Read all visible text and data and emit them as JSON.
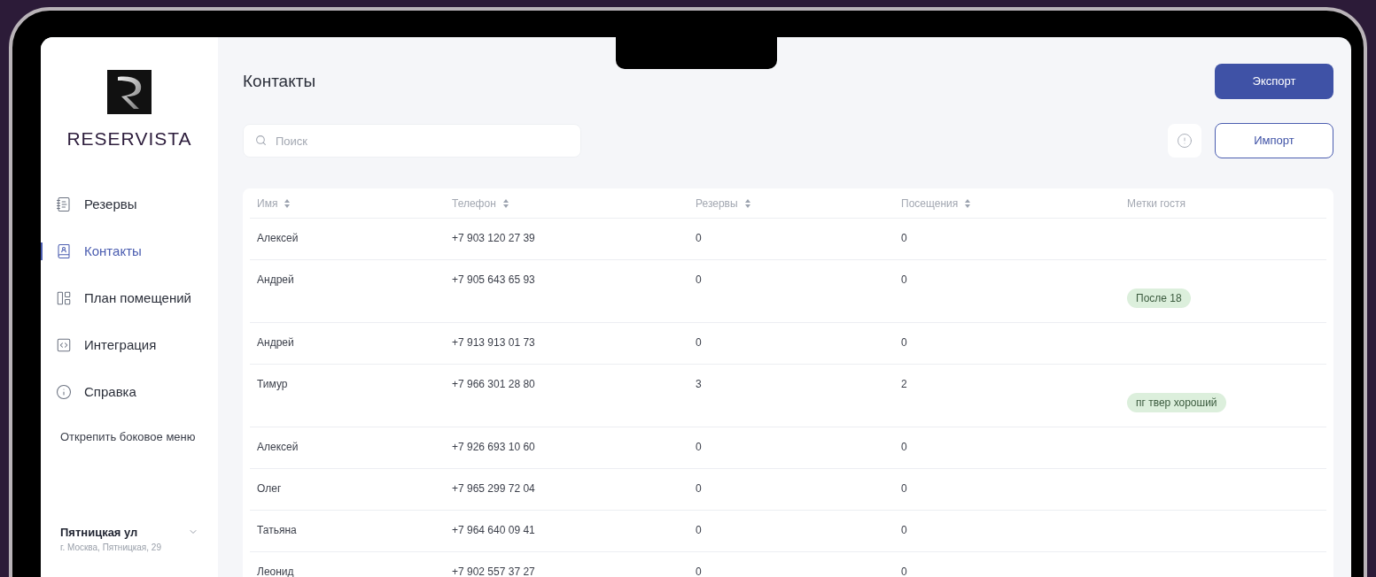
{
  "brand": {
    "name": "RESERVISTA"
  },
  "sidebar": {
    "items": [
      {
        "label": "Резервы",
        "selected": false
      },
      {
        "label": "Контакты",
        "selected": true
      },
      {
        "label": "План помещений",
        "selected": false
      },
      {
        "label": "Интеграция",
        "selected": false
      },
      {
        "label": "Справка",
        "selected": false
      }
    ],
    "unpin": "Открепить боковое меню",
    "location": {
      "name": "Пятницкая ул",
      "address": "г. Москва, Пятницкая, 29"
    }
  },
  "page": {
    "title": "Контакты",
    "export": "Экспорт",
    "import": "Импорт",
    "search": {
      "placeholder": "Поиск"
    }
  },
  "table": {
    "columns": [
      {
        "label": "Имя",
        "sortable": true
      },
      {
        "label": "Телефон",
        "sortable": true
      },
      {
        "label": "Резервы",
        "sortable": true
      },
      {
        "label": "Посещения",
        "sortable": true
      },
      {
        "label": "Метки гостя",
        "sortable": false
      }
    ],
    "rows": [
      {
        "name": "Алексей",
        "phone": "+7 903 120 27 39",
        "reserves": "0",
        "visits": "0"
      },
      {
        "name": "Андрей",
        "phone": "+7 905 643 65 93",
        "reserves": "0",
        "visits": "0",
        "tag": "После 18"
      },
      {
        "name": "Андрей",
        "phone": "+7 913 913 01 73",
        "reserves": "0",
        "visits": "0"
      },
      {
        "name": "Тимур",
        "phone": "+7 966 301 28 80",
        "reserves": "3",
        "visits": "2",
        "tag": "пг твер хороший"
      },
      {
        "name": "Алексей",
        "phone": "+7 926 693 10 60",
        "reserves": "0",
        "visits": "0"
      },
      {
        "name": "Олег",
        "phone": "+7 965 299 72 04",
        "reserves": "0",
        "visits": "0"
      },
      {
        "name": "Татьяна",
        "phone": "+7 964 640 09 41",
        "reserves": "0",
        "visits": "0"
      },
      {
        "name": "Леонид",
        "phone": "+7 902 557 37 27",
        "reserves": "0",
        "visits": "0"
      }
    ]
  }
}
